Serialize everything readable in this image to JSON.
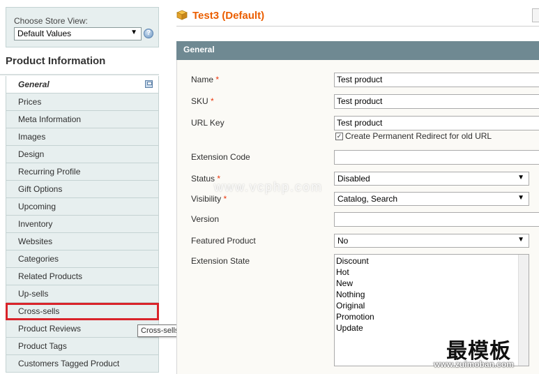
{
  "store_switcher": {
    "label": "Choose Store View:",
    "selected": "Default Values",
    "help_icon": "help-icon"
  },
  "sidebar": {
    "title": "Product Information",
    "active_tab": "General",
    "items": [
      {
        "label": "General"
      },
      {
        "label": "Prices"
      },
      {
        "label": "Meta Information"
      },
      {
        "label": "Images"
      },
      {
        "label": "Design"
      },
      {
        "label": "Recurring Profile"
      },
      {
        "label": "Gift Options"
      },
      {
        "label": "Upcoming"
      },
      {
        "label": "Inventory"
      },
      {
        "label": "Websites"
      },
      {
        "label": "Categories"
      },
      {
        "label": "Related Products"
      },
      {
        "label": "Up-sells"
      },
      {
        "label": "Cross-sells"
      },
      {
        "label": "Product Reviews"
      },
      {
        "label": "Product Tags"
      },
      {
        "label": "Customers Tagged Product"
      }
    ],
    "highlighted_tab": "Cross-sells",
    "highlight_color": "#d9232a"
  },
  "tooltip": {
    "text": "Cross-sells"
  },
  "header": {
    "title": "Test3 (Default)",
    "title_color": "#eb5e00",
    "icon": "box-icon"
  },
  "section": {
    "title": "General",
    "header_color": "#6f8992"
  },
  "form": {
    "name": {
      "label": "Name",
      "required": "*",
      "value": "Test product"
    },
    "sku": {
      "label": "SKU",
      "required": "*",
      "value": "Test product"
    },
    "url_key": {
      "label": "URL Key",
      "value": "Test product",
      "checkbox_label": "Create Permanent Redirect for old URL",
      "checkbox_checked": true
    },
    "extension_code": {
      "label": "Extension Code",
      "value": ""
    },
    "status": {
      "label": "Status",
      "required": "*",
      "value": "Disabled"
    },
    "visibility": {
      "label": "Visibility",
      "required": "*",
      "value": "Catalog, Search"
    },
    "version": {
      "label": "Version",
      "value": ""
    },
    "featured_product": {
      "label": "Featured Product",
      "value": "No"
    },
    "extension_state": {
      "label": "Extension State",
      "options": [
        "Discount",
        "Hot",
        "New",
        "Nothing",
        "Original",
        "Promotion",
        "Update"
      ]
    }
  },
  "watermarks": {
    "mid_text": "www.vcphp.com",
    "logo_text": "最模板",
    "url_text": "www.zuimoban.com"
  }
}
